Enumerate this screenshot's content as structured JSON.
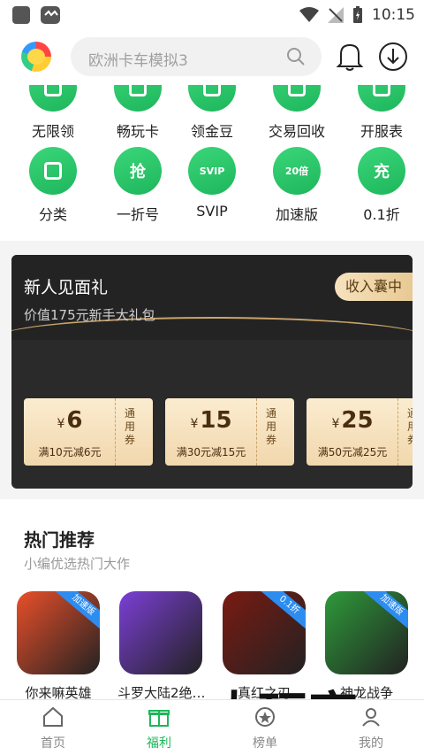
{
  "status_bar": {
    "time": "10:15"
  },
  "search": {
    "placeholder": "欧洲卡车模拟3"
  },
  "quick_menu": [
    {
      "label": "无限领",
      "icon": "gift-icon"
    },
    {
      "label": "畅玩卡",
      "icon": "card-icon"
    },
    {
      "label": "领金豆",
      "icon": "bean-icon"
    },
    {
      "label": "交易回收",
      "icon": "recycle-icon"
    },
    {
      "label": "开服表",
      "icon": "calendar-icon"
    },
    {
      "label": "分类",
      "icon": "category-icon"
    },
    {
      "label": "一折号",
      "icon": "grab-icon",
      "glyph": "抢"
    },
    {
      "label": "SVIP",
      "icon": "svip-diamond-icon",
      "glyph": "SVIP"
    },
    {
      "label": "加速版",
      "icon": "speed-icon",
      "glyph": "20倍"
    },
    {
      "label": "0.1折",
      "icon": "recharge-icon",
      "glyph": "充"
    }
  ],
  "gift_pack": {
    "title": "新人见面礼",
    "subtitle": "价值175元新手大礼包",
    "button": "收入囊中",
    "coupons": [
      {
        "currency": "¥",
        "amount": "6",
        "desc": "满10元减6元",
        "type": "通用券"
      },
      {
        "currency": "¥",
        "amount": "15",
        "desc": "满30元减15元",
        "type": "通用券"
      },
      {
        "currency": "¥",
        "amount": "25",
        "desc": "满50元减25元",
        "type": "通用券"
      }
    ]
  },
  "hot": {
    "title": "热门推荐",
    "subtitle": "小编优选热门大作",
    "games": [
      {
        "name": "你来嘛英雄",
        "badge": "加速版",
        "color": "#e94f2a"
      },
      {
        "name": "斗罗大陆2绝…",
        "badge": "",
        "color": "#7b3fd6"
      },
      {
        "name": "真红之刃",
        "badge": "0.1折",
        "color": "#7a1a12"
      },
      {
        "name": "神龙战争",
        "badge": "加速版",
        "color": "#2e9a3a"
      }
    ]
  },
  "tabs": [
    {
      "label": "首页",
      "icon": "home-icon"
    },
    {
      "label": "福利",
      "icon": "gift-box-icon"
    },
    {
      "label": "榜单",
      "icon": "star-icon"
    },
    {
      "label": "我的",
      "icon": "user-icon"
    }
  ],
  "active_tab": "福利",
  "watermark": "大玩家",
  "colors": {
    "accent": "#1db65a",
    "gold": "#e8c994"
  }
}
